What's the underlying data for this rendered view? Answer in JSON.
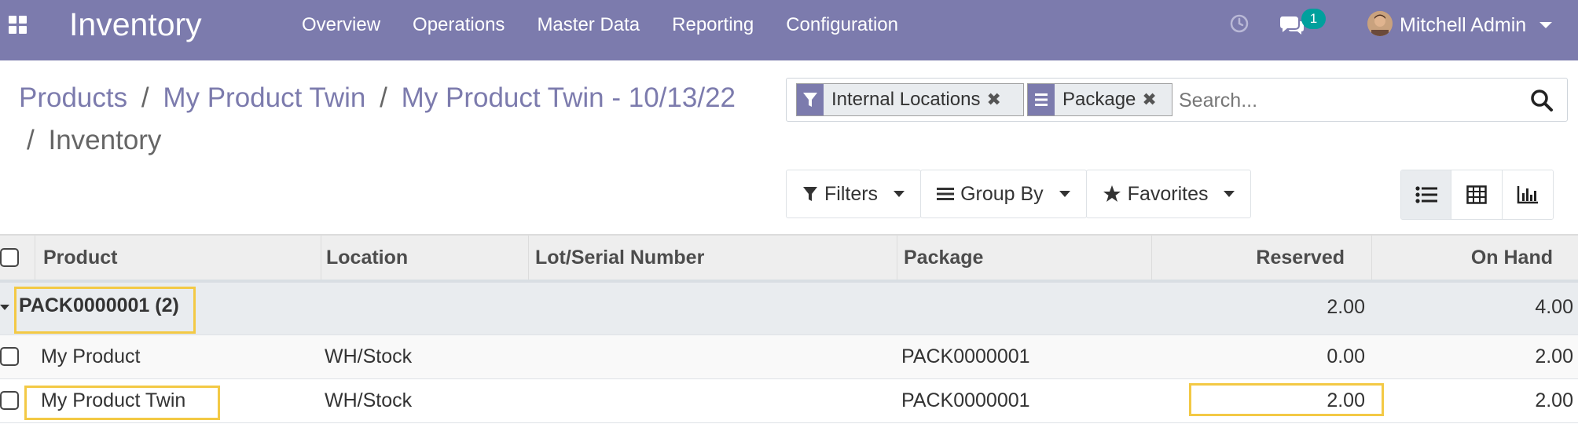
{
  "navbar": {
    "app_title": "Inventory",
    "menu": [
      "Overview",
      "Operations",
      "Master Data",
      "Reporting",
      "Configuration"
    ],
    "notification_count": "1",
    "user_name": "Mitchell Admin"
  },
  "breadcrumb": {
    "items": [
      "Products",
      "My Product Twin",
      "My Product Twin - 10/13/22"
    ],
    "separator": "/",
    "current": "Inventory"
  },
  "search": {
    "facets": [
      {
        "icon": "filter-icon",
        "label": "Internal Locations"
      },
      {
        "icon": "group-by-icon",
        "label": "Package"
      }
    ],
    "placeholder": "Search..."
  },
  "filter_bar": {
    "filters": "Filters",
    "group_by": "Group By",
    "favorites": "Favorites"
  },
  "views": [
    "list-view-icon",
    "pivot-view-icon",
    "graph-view-icon"
  ],
  "table": {
    "columns": [
      "Product",
      "Location",
      "Lot/Serial Number",
      "Package",
      "Reserved",
      "On Hand"
    ],
    "group": {
      "label": "PACK0000001 (2)",
      "reserved": "2.00",
      "on_hand": "4.00"
    },
    "rows": [
      {
        "product": "My Product",
        "location": "WH/Stock",
        "lot": "",
        "package": "PACK0000001",
        "reserved": "0.00",
        "on_hand": "2.00"
      },
      {
        "product": "My Product Twin",
        "location": "WH/Stock",
        "lot": "",
        "package": "PACK0000001",
        "reserved": "2.00",
        "on_hand": "2.00"
      }
    ]
  },
  "colors": {
    "brand": "#7c7bad",
    "badge": "#00a09d",
    "highlight": "#f3c945"
  }
}
